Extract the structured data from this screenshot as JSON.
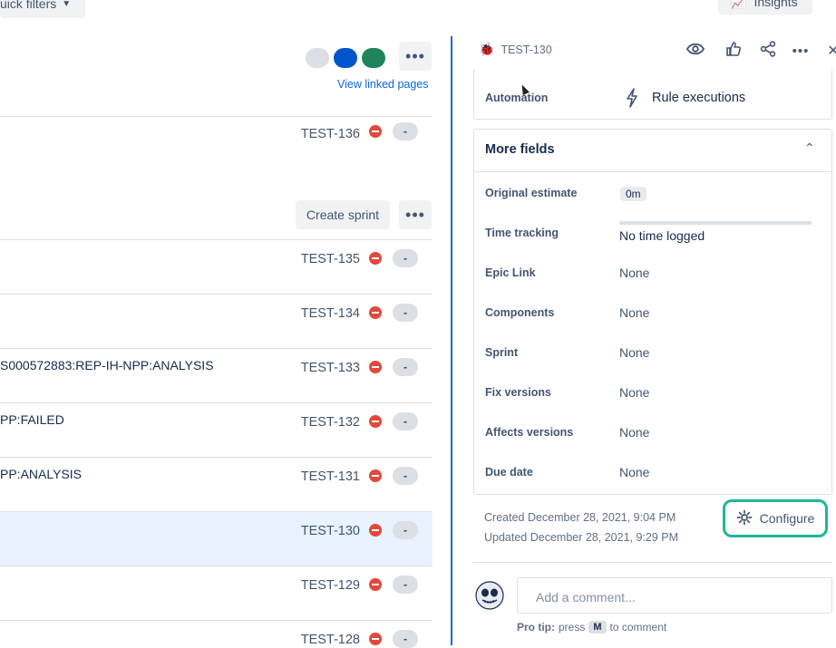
{
  "top": {
    "quick_filters_label": "uick filters",
    "insights_label": "Insights"
  },
  "board": {
    "view_linked_pages": "View linked pages",
    "top_row": {
      "key": "TEST-136",
      "status": "-"
    },
    "create_sprint_label": "Create sprint",
    "rows": [
      {
        "summary": "",
        "key": "TEST-135",
        "status": "-"
      },
      {
        "summary": "",
        "key": "TEST-134",
        "status": "-"
      },
      {
        "summary": "S000572883:REP-IH-NPP:ANALYSIS",
        "key": "TEST-133",
        "status": "-"
      },
      {
        "summary": "PP:FAILED",
        "key": "TEST-132",
        "status": "-"
      },
      {
        "summary": "PP:ANALYSIS",
        "key": "TEST-131",
        "status": "-"
      },
      {
        "summary": "",
        "key": "TEST-130",
        "status": "-"
      },
      {
        "summary": "",
        "key": "TEST-129",
        "status": "-"
      },
      {
        "summary": "",
        "key": "TEST-128",
        "status": "-"
      }
    ],
    "avatar_colors": [
      "#dcdfe4",
      "#0055cc",
      "#1f845a"
    ]
  },
  "issue": {
    "key": "TEST-130",
    "automation_label": "Automation",
    "automation_value": "Rule executions",
    "more_fields_title": "More fields",
    "fields": [
      {
        "label": "Original estimate",
        "value": "0m"
      },
      {
        "label": "Time tracking",
        "value": "No time logged"
      },
      {
        "label": "Epic Link",
        "value": "None"
      },
      {
        "label": "Components",
        "value": "None"
      },
      {
        "label": "Sprint",
        "value": "None"
      },
      {
        "label": "Fix versions",
        "value": "None"
      },
      {
        "label": "Affects versions",
        "value": "None"
      },
      {
        "label": "Due date",
        "value": "None"
      }
    ],
    "created": "Created December 28, 2021, 9:04 PM",
    "updated": "Updated December 28, 2021, 9:29 PM",
    "configure_label": "Configure",
    "comment_placeholder": "Add a comment...",
    "protip_prefix": "Pro tip:",
    "protip_press": "press",
    "protip_key": "M",
    "protip_suffix": "to comment"
  },
  "colors": {
    "accent": "#1868db",
    "highlight": "#22b59a",
    "priority": "#e2483d"
  }
}
